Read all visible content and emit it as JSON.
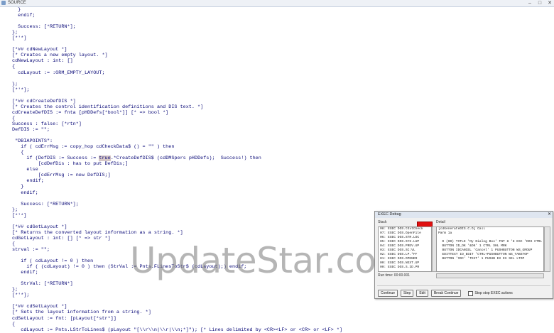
{
  "window": {
    "title": "SOURCE",
    "controls": [
      "–",
      "□",
      "✕"
    ]
  },
  "code_lines": [
    "  }",
    "  endif;",
    "",
    "  Success: [*RETURN*];",
    "};",
    "[*'*]",
    "",
    "[*## cdNewLayout *]",
    "[* Creates a new empty layout. *]",
    "cdNewLayout : int: []",
    "{",
    "  cdLayout := :ORM_EMPTY_LAYOUT;",
    "",
    "};",
    "[*'*];",
    "",
    "[*## cdCreateDefDIS *]",
    "[* Creates the control identification definitions and DIS text. *]",
    "cdCreateDefDIS := fnta [pHDDefs[*bool*]] [* => bool *]",
    "{",
    "Success : false: [*rtn*]",
    "DefDIS := \"\";",
    "",
    " \"DBIAPOINTS\":",
    "   if ( cdErrMsg := copy_hop cdCheckData$ () = \"\" ) then",
    "   {",
    "     if (DefDIS := Success := true.*CreateDefDIS$ (cdDMSpers pHDDefs);  Success!) then",
    "         [cdDefDis : has to put DefDis;]",
    "     else",
    "         [cdErrMsg := new DefDIS;]",
    "     endif;",
    "   }",
    "   endif;",
    "",
    "   Success: [*RETURN*];",
    "};",
    "[*'*]",
    "",
    "[*## cdGetLayout *]",
    "[* Returns the converted layout information as a string. *]",
    "cdGetLayout : int: [] [* => str *]",
    "{",
    "strval := \"\";",
    "",
    "   if ( cdLayout != 0 ) then",
    "     if ( (cdLayout) != 0 ) then (StrVal := Pnts.FLinesToStr$ (cdLayout);) endif;",
    "   endif;",
    "",
    "   StrVal: [*RETURN*]",
    "};",
    "[*'*];",
    "",
    "[*## cdSetLayout *]",
    "[* Sets the layout information from a string. *]",
    "cdSetLayout := fnt: [pLayout[*str*]]",
    "{",
    "   cdLayout := Pnts.LStrToLines$ (pLayout \"[\\\\r\\\\n|\\\\r|\\\\n;*]\"); [* Lines delimited by <CR><LF> or <CR> or <LF> *]"
  ],
  "highlight": {
    "line": 26,
    "text": "true"
  },
  "watermark": "UpdateStar.com",
  "debug_dialog": {
    "title": "EXEC Debug",
    "left_label": "Stack",
    "right_label": "Detail",
    "left_items": [
      "08: EXEC DOS.tExtCheck",
      "07: EXEC DOS.OpenFile",
      "06: EXEC DOS.STR.LOC",
      "05: EXEC DOS.SYS.LUP",
      "04: EXEC DOS.PREV.UP",
      "03: EXEC DOS.SC:VL",
      "02: EXEC DOS.LP.*FF",
      "01: EXEC DOS.OPENER",
      "00: EXEC DOS.NEXT.UP",
      "00: EXEC DOS.S.ID.PR"
    ],
    "right_items": [
      "[cdGenerateDIS.C.O] Call",
      "Parm 1a",
      "",
      "  D (00) TITLE 'My Dialog Box' FNT 8 '8 ESC 'DOS CTRL SHL",
      "  BUTTON ID_OK '&OK' 1 CTRL SHL MRK",
      "  BUTTON IDCANCEL 'Cancel' 1 PUSHBUTTON WS_GROUP",
      "  EDITTEXT ID_EDIT 'CTRL+PUSHBUTTON WS_TABSTOP",
      "  BUTTON 'IDC' 'TEXT' 1 PUSHB EX EX SEL LTOP"
    ],
    "status": "Run time: 00:00.001",
    "buttons": [
      "Continue",
      "Step",
      "Edit",
      "Break Continue"
    ],
    "checkbox_label": "Stop stop EXEC actions"
  }
}
